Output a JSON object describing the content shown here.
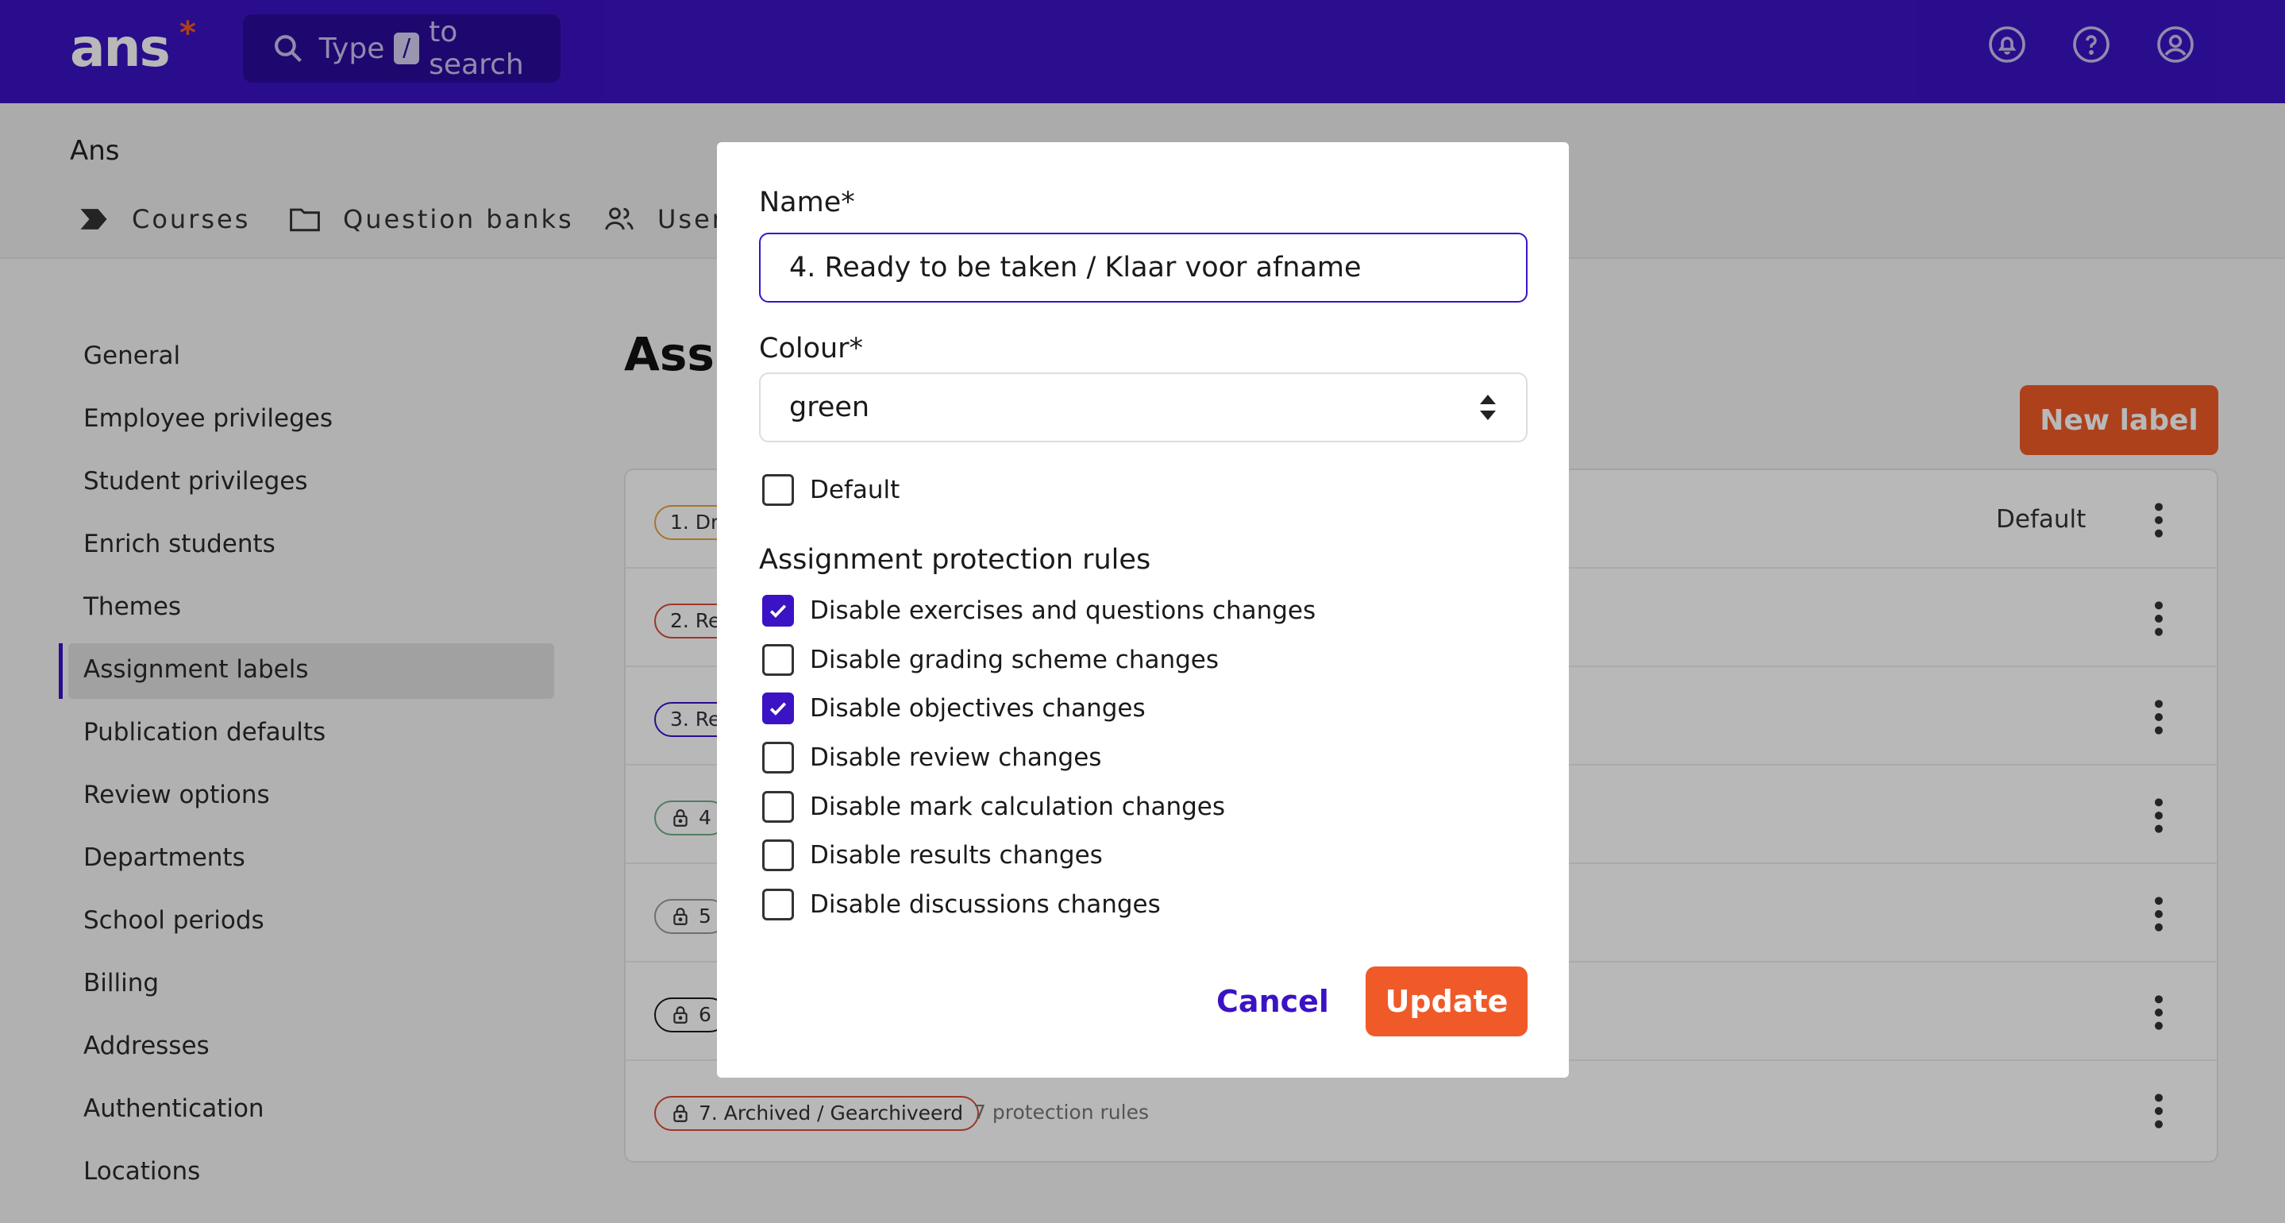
{
  "header": {
    "logo": "ans",
    "logo_star": "*",
    "search": {
      "prefix": "Type",
      "key": "/",
      "suffix": "to search"
    }
  },
  "subheader": {
    "org": "Ans",
    "tabs": [
      {
        "label": "Courses",
        "icon": "chevron-tag-icon"
      },
      {
        "label": "Question banks",
        "icon": "folder-icon"
      },
      {
        "label": "User",
        "icon": "users-icon"
      }
    ]
  },
  "sidebar": {
    "items": [
      {
        "label": "General"
      },
      {
        "label": "Employee privileges"
      },
      {
        "label": "Student privileges"
      },
      {
        "label": "Enrich students"
      },
      {
        "label": "Themes"
      },
      {
        "label": "Assignment labels",
        "active": true
      },
      {
        "label": "Publication defaults"
      },
      {
        "label": "Review options"
      },
      {
        "label": "Departments"
      },
      {
        "label": "School periods"
      },
      {
        "label": "Billing"
      },
      {
        "label": "Addresses"
      },
      {
        "label": "Authentication"
      },
      {
        "label": "Locations"
      }
    ]
  },
  "main": {
    "title": "Assig",
    "new_label": "New label",
    "rows": [
      {
        "tag": "1. Dr",
        "color": "#e8a33a",
        "locked": false,
        "default": "Default"
      },
      {
        "tag": "2. Re",
        "color": "#d94b3a",
        "locked": false
      },
      {
        "tag": "3. Re",
        "color": "#3b13c4",
        "locked": false
      },
      {
        "tag": "4",
        "color": "#6fae86",
        "locked": true
      },
      {
        "tag": "5",
        "color": "#9a9a9a",
        "locked": true
      },
      {
        "tag": "6",
        "color": "#1a1a1a",
        "locked": true
      },
      {
        "tag": "7. Archived / Gearchiveerd",
        "color": "#d94b3a",
        "locked": true,
        "protection": "7 protection rules"
      }
    ]
  },
  "modal": {
    "name_label": "Name*",
    "name_value": "4. Ready to be taken / Klaar voor afname",
    "colour_label": "Colour*",
    "colour_value": "green",
    "default_label": "Default",
    "default_checked": false,
    "section_title": "Assignment protection rules",
    "rules": [
      {
        "label": "Disable exercises and questions changes",
        "checked": true
      },
      {
        "label": "Disable grading scheme changes",
        "checked": false
      },
      {
        "label": "Disable objectives changes",
        "checked": true
      },
      {
        "label": "Disable review changes",
        "checked": false
      },
      {
        "label": "Disable mark calculation changes",
        "checked": false
      },
      {
        "label": "Disable results changes",
        "checked": false
      },
      {
        "label": "Disable discussions changes",
        "checked": false
      }
    ],
    "cancel_label": "Cancel",
    "update_label": "Update"
  },
  "colors": {
    "brand": "#3b13c4",
    "accent": "#f05a28"
  }
}
